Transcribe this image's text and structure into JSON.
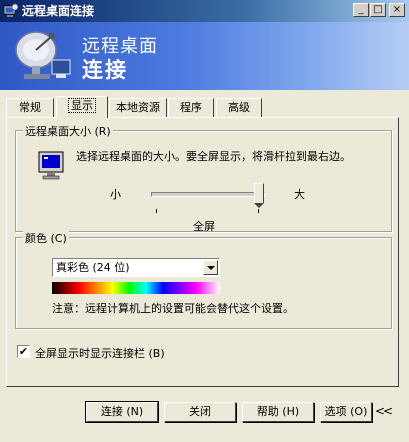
{
  "window": {
    "title": "远程桌面连接",
    "min_glyph": "_",
    "max_glyph": "□",
    "close_glyph": "×"
  },
  "banner": {
    "line1": "远程桌面",
    "line2": "连接"
  },
  "tabs": [
    {
      "label": "常规",
      "active": false
    },
    {
      "label": "显示",
      "active": true
    },
    {
      "label": "本地资源",
      "active": false
    },
    {
      "label": "程序",
      "active": false
    },
    {
      "label": "高级",
      "active": false
    }
  ],
  "size_group": {
    "legend": "远程桌面大小 (R)",
    "description": "选择远程桌面的大小。要全屏显示，将滑杆拉到最右边。",
    "small_label": "小",
    "large_label": "大",
    "current_label": "全屏",
    "slider_level": 1.0
  },
  "color_group": {
    "legend": "颜色 (C)",
    "selected": "真彩色 (24 位)",
    "note": "注意：远程计算机上的设置可能会替代这个设置。"
  },
  "fullscreen_checkbox": {
    "label": "全屏显示时显示连接栏 (B)",
    "checked": true,
    "glyph": "✔"
  },
  "buttons": {
    "connect": "连接 (N)",
    "close": "关闭",
    "help": "帮助 (H)",
    "options": "选项 (O)",
    "collapse_glyph": "<<"
  },
  "colors": {
    "titlebar": "#0a246a",
    "banner": "#3a64d0",
    "face": "#ece9d8"
  }
}
